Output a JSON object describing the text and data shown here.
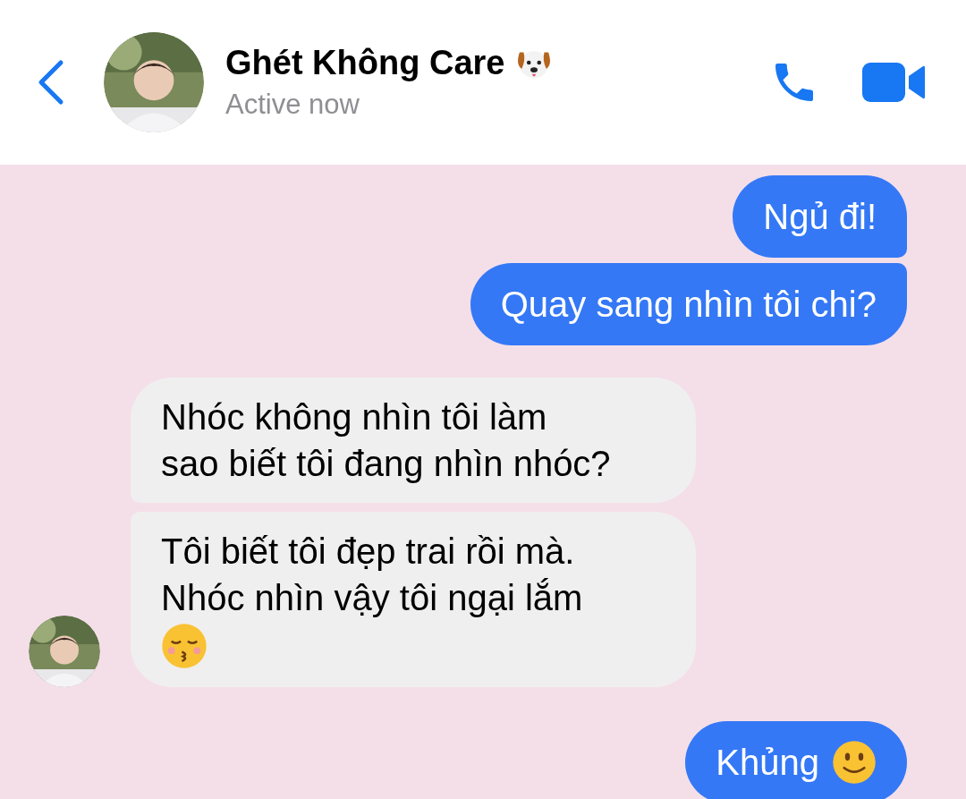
{
  "header": {
    "name": "Ghét Không Care",
    "name_icon": true,
    "status": "Active now"
  },
  "messages": [
    {
      "outgoing": true,
      "text": "Ngủ đi!",
      "kind": "plain"
    },
    {
      "outgoing": true,
      "text": "Quay sang nhìn tôi chi?",
      "kind": "plain"
    },
    {
      "outgoing": false,
      "text": "Nhóc không nhìn tôi làm sao biết tôi đang nhìn nhóc?",
      "kind": "plain",
      "avatar": false
    },
    {
      "outgoing": false,
      "text": "Tôi biết tôi đẹp trai rồi mà. Nhóc nhìn vậy tôi ngại lắm",
      "kind": "kiss",
      "avatar": true
    },
    {
      "outgoing": true,
      "text": "Khủng",
      "kind": "smile"
    }
  ]
}
